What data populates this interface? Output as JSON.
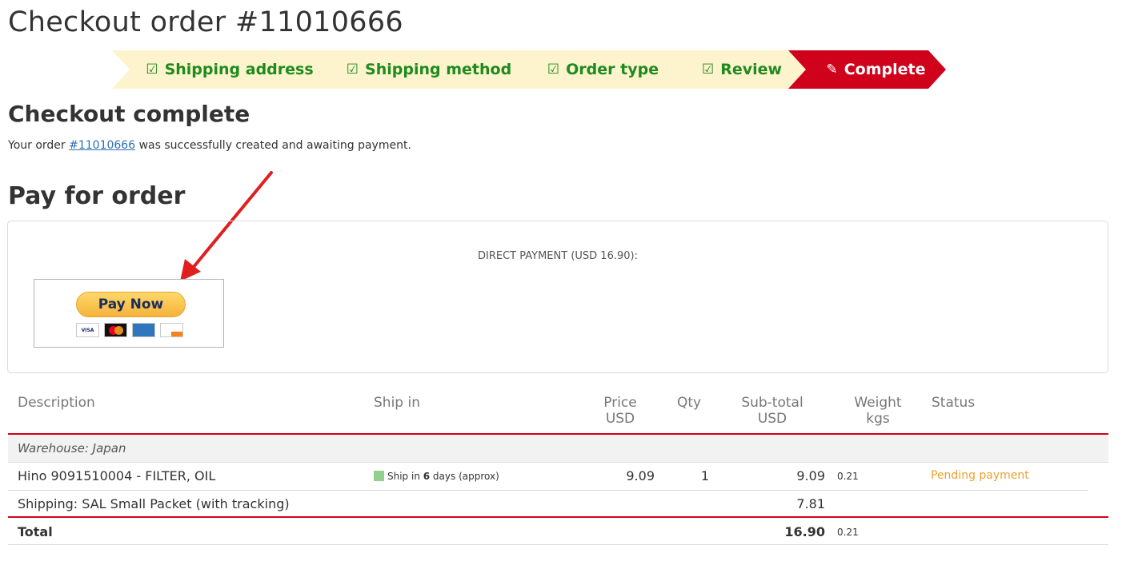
{
  "page": {
    "title": "Checkout order #11010666"
  },
  "steps": [
    {
      "label": "Shipping address",
      "icon": "check-square-icon"
    },
    {
      "label": "Shipping method",
      "icon": "check-square-icon"
    },
    {
      "label": "Order type",
      "icon": "check-square-icon"
    },
    {
      "label": "Review",
      "icon": "check-square-icon"
    },
    {
      "label": "Complete",
      "icon": "edit-icon"
    }
  ],
  "colors": {
    "step_done_bg": "#fdf3cd",
    "step_done_text": "#1e8b1e",
    "step_active_bg": "#d0021b",
    "accent_red": "#d0021b",
    "link": "#2a6fb5",
    "pending": "#f0a030"
  },
  "complete": {
    "heading": "Checkout complete",
    "msg_prefix": "Your order ",
    "order_link": "#11010666",
    "msg_suffix": " was successfully created and awaiting payment."
  },
  "pay": {
    "heading": "Pay for order",
    "direct_label": "DIRECT PAYMENT (USD 16.90):",
    "button_label": "Pay Now",
    "cards": [
      "VISA",
      "mastercard",
      "AMEX",
      "DISCOVER"
    ]
  },
  "table": {
    "headers": {
      "description": "Description",
      "ship_in": "Ship in",
      "price_line1": "Price",
      "price_line2": "USD",
      "qty": "Qty",
      "subtotal_line1": "Sub-total",
      "subtotal_line2": "USD",
      "weight_line1": "Weight",
      "weight_line2": "kgs",
      "status": "Status"
    },
    "warehouse": "Warehouse: Japan",
    "item": {
      "description": "Hino 9091510004 - FILTER, OIL",
      "ship_prefix": "Ship in ",
      "ship_days": "6",
      "ship_suffix": " days (approx)",
      "price": "9.09",
      "qty": "1",
      "subtotal": "9.09",
      "weight": "0.21",
      "status": "Pending payment"
    },
    "shipping": {
      "description": "Shipping: SAL Small Packet (with tracking)",
      "subtotal": "7.81"
    },
    "total": {
      "label": "Total",
      "subtotal": "16.90",
      "weight": "0.21"
    }
  }
}
